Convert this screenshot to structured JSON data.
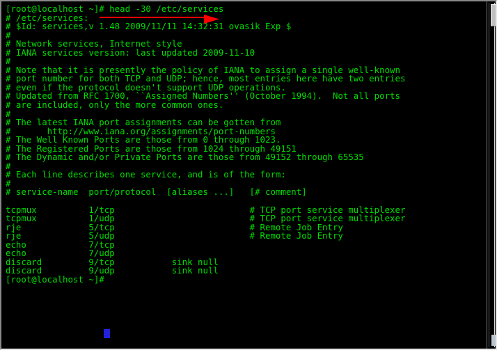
{
  "window": {
    "kind": "terminal-emulator",
    "background_color": "#000000",
    "text_color": "#00dd00",
    "cursor_color": "#2222dd",
    "annotation_color": "#ff0000"
  },
  "terminal": {
    "prompt": "[root@localhost ~]#",
    "command": "head -30 /etc/services",
    "command_line": "[root@localhost ~]# head -30 /etc/services",
    "final_prompt_line": "[root@localhost ~]# ",
    "cursor": "block",
    "lines": [
      "[root@localhost ~]# head -30 /etc/services",
      "# /etc/services:",
      "# $Id: services,v 1.48 2009/11/11 14:32:31 ovasik Exp $",
      "#",
      "# Network services, Internet style",
      "# IANA services version: last updated 2009-11-10",
      "#",
      "# Note that it is presently the policy of IANA to assign a single well-known",
      "# port number for both TCP and UDP; hence, most entries here have two entries",
      "# even if the protocol doesn't support UDP operations.",
      "# Updated from RFC 1700, ``Assigned Numbers'' (October 1994).  Not all ports",
      "# are included, only the more common ones.",
      "#",
      "# The latest IANA port assignments can be gotten from",
      "#       http://www.iana.org/assignments/port-numbers",
      "# The Well Known Ports are those from 0 through 1023.",
      "# The Registered Ports are those from 1024 through 49151",
      "# The Dynamic and/or Private Ports are those from 49152 through 65535",
      "#",
      "# Each line describes one service, and is of the form:",
      "#",
      "# service-name  port/protocol  [aliases ...]   [# comment]",
      "",
      "tcpmux          1/tcp                          # TCP port service multiplexer",
      "tcpmux          1/udp                          # TCP port service multiplexer",
      "rje             5/tcp                          # Remote Job Entry",
      "rje             5/udp                          # Remote Job Entry",
      "echo            7/tcp",
      "echo            7/udp",
      "discard         9/tcp           sink null",
      "discard         9/udp           sink null",
      "[root@localhost ~]# "
    ]
  },
  "file_header": {
    "path_comment": "# /etc/services:",
    "rcs_id": "# $Id: services,v 1.48 2009/11/11 14:32:31 ovasik Exp $",
    "description": "# Network services, Internet style",
    "iana_version": "# IANA services version: last updated 2009-11-10",
    "iana_url": "http://www.iana.org/assignments/port-numbers",
    "well_known_ports": "# The Well Known Ports are those from 0 through 1023.",
    "registered_ports": "# The Registered Ports are those from 1024 through 49151",
    "dynamic_ports": "# The Dynamic and/or Private Ports are those from 49152 through 65535",
    "format_line": "# service-name  port/protocol  [aliases ...]   [# comment]"
  },
  "services_table": {
    "columns": [
      "service-name",
      "port/protocol",
      "aliases",
      "comment"
    ],
    "rows": [
      {
        "name": "tcpmux",
        "port": "1/tcp",
        "aliases": "",
        "comment": "# TCP port service multiplexer"
      },
      {
        "name": "tcpmux",
        "port": "1/udp",
        "aliases": "",
        "comment": "# TCP port service multiplexer"
      },
      {
        "name": "rje",
        "port": "5/tcp",
        "aliases": "",
        "comment": "# Remote Job Entry"
      },
      {
        "name": "rje",
        "port": "5/udp",
        "aliases": "",
        "comment": "# Remote Job Entry"
      },
      {
        "name": "echo",
        "port": "7/tcp",
        "aliases": "",
        "comment": ""
      },
      {
        "name": "echo",
        "port": "7/udp",
        "aliases": "",
        "comment": ""
      },
      {
        "name": "discard",
        "port": "9/tcp",
        "aliases": "sink null",
        "comment": ""
      },
      {
        "name": "discard",
        "port": "9/udp",
        "aliases": "sink null",
        "comment": ""
      }
    ]
  },
  "annotation": {
    "type": "red-underline-arrow",
    "targets": "head -30 /etc/services",
    "direction": "right"
  },
  "scrollbar": {
    "orientation": "vertical",
    "thumb_position": "top"
  }
}
